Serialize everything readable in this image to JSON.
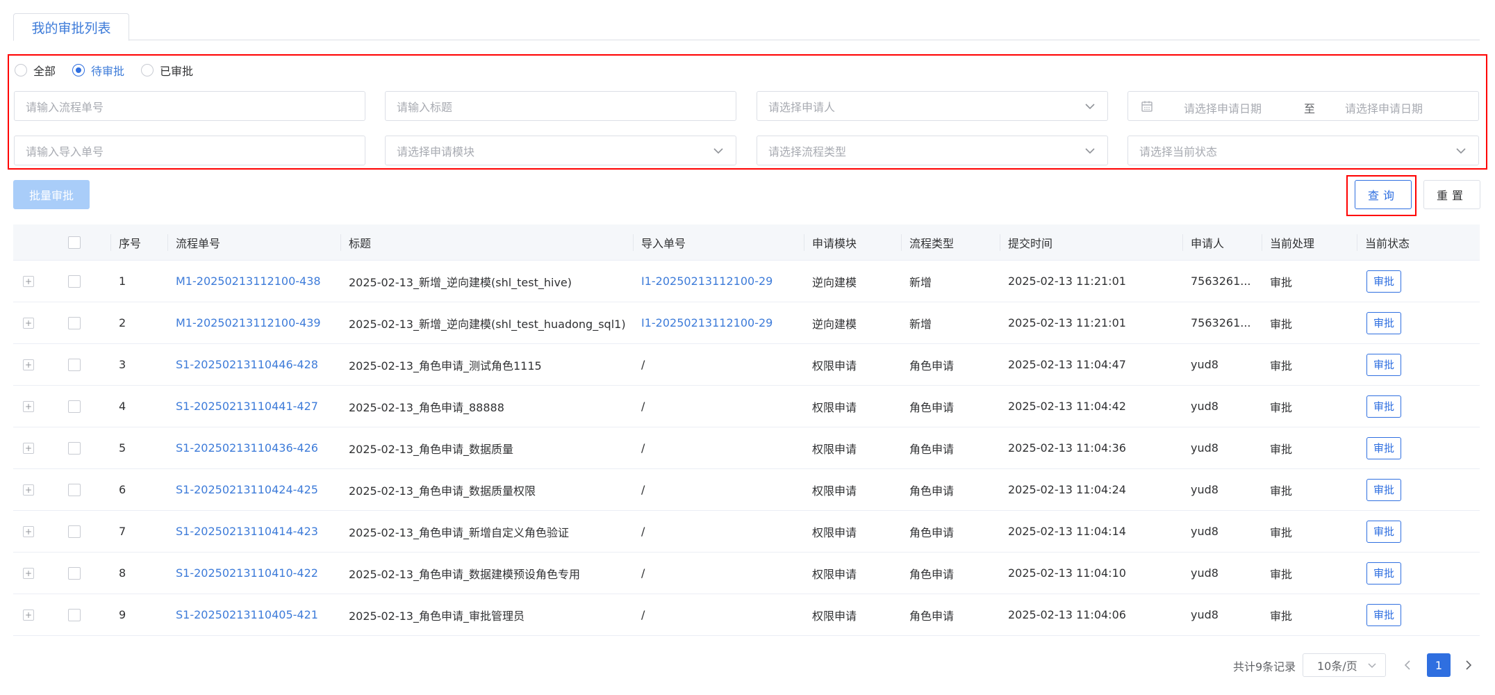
{
  "tab": {
    "label": "我的审批列表"
  },
  "filters": {
    "radios": [
      {
        "label": "全部",
        "checked": false
      },
      {
        "label": "待审批",
        "checked": true
      },
      {
        "label": "已审批",
        "checked": false
      }
    ],
    "process_no_placeholder": "请输入流程单号",
    "title_placeholder": "请输入标题",
    "applicant_placeholder": "请选择申请人",
    "date_start_placeholder": "请选择申请日期",
    "date_separator": "至",
    "date_end_placeholder": "请选择申请日期",
    "import_no_placeholder": "请输入导入单号",
    "module_placeholder": "请选择申请模块",
    "process_type_placeholder": "请选择流程类型",
    "status_placeholder": "请选择当前状态"
  },
  "buttons": {
    "batch": "批量审批",
    "query": "查询",
    "reset": "重置"
  },
  "table": {
    "headers": {
      "index": "序号",
      "process_no": "流程单号",
      "title": "标题",
      "import_no": "导入单号",
      "module": "申请模块",
      "process_type": "流程类型",
      "submit_time": "提交时间",
      "applicant": "申请人",
      "handler": "当前处理",
      "status": "当前状态"
    },
    "rows": [
      {
        "index": "1",
        "process_no": "M1-20250213112100-438",
        "title": "2025-02-13_新增_逆向建模(shl_test_hive)",
        "import_no": "I1-20250213112100-29",
        "import_is_link": true,
        "module": "逆向建模",
        "process_type": "新增",
        "submit_time": "2025-02-13 11:21:01",
        "applicant": "7563261...",
        "handler": "审批",
        "status": "审批"
      },
      {
        "index": "2",
        "process_no": "M1-20250213112100-439",
        "title": "2025-02-13_新增_逆向建模(shl_test_huadong_sql1)",
        "import_no": "I1-20250213112100-29",
        "import_is_link": true,
        "module": "逆向建模",
        "process_type": "新增",
        "submit_time": "2025-02-13 11:21:01",
        "applicant": "7563261...",
        "handler": "审批",
        "status": "审批"
      },
      {
        "index": "3",
        "process_no": "S1-20250213110446-428",
        "title": "2025-02-13_角色申请_测试角色1115",
        "import_no": "/",
        "import_is_link": false,
        "module": "权限申请",
        "process_type": "角色申请",
        "submit_time": "2025-02-13 11:04:47",
        "applicant": "yud8",
        "handler": "审批",
        "status": "审批"
      },
      {
        "index": "4",
        "process_no": "S1-20250213110441-427",
        "title": "2025-02-13_角色申请_88888",
        "import_no": "/",
        "import_is_link": false,
        "module": "权限申请",
        "process_type": "角色申请",
        "submit_time": "2025-02-13 11:04:42",
        "applicant": "yud8",
        "handler": "审批",
        "status": "审批"
      },
      {
        "index": "5",
        "process_no": "S1-20250213110436-426",
        "title": "2025-02-13_角色申请_数据质量",
        "import_no": "/",
        "import_is_link": false,
        "module": "权限申请",
        "process_type": "角色申请",
        "submit_time": "2025-02-13 11:04:36",
        "applicant": "yud8",
        "handler": "审批",
        "status": "审批"
      },
      {
        "index": "6",
        "process_no": "S1-20250213110424-425",
        "title": "2025-02-13_角色申请_数据质量权限",
        "import_no": "/",
        "import_is_link": false,
        "module": "权限申请",
        "process_type": "角色申请",
        "submit_time": "2025-02-13 11:04:24",
        "applicant": "yud8",
        "handler": "审批",
        "status": "审批"
      },
      {
        "index": "7",
        "process_no": "S1-20250213110414-423",
        "title": "2025-02-13_角色申请_新增自定义角色验证",
        "import_no": "/",
        "import_is_link": false,
        "module": "权限申请",
        "process_type": "角色申请",
        "submit_time": "2025-02-13 11:04:14",
        "applicant": "yud8",
        "handler": "审批",
        "status": "审批"
      },
      {
        "index": "8",
        "process_no": "S1-20250213110410-422",
        "title": "2025-02-13_角色申请_数据建模预设角色专用",
        "import_no": "/",
        "import_is_link": false,
        "module": "权限申请",
        "process_type": "角色申请",
        "submit_time": "2025-02-13 11:04:10",
        "applicant": "yud8",
        "handler": "审批",
        "status": "审批"
      },
      {
        "index": "9",
        "process_no": "S1-20250213110405-421",
        "title": "2025-02-13_角色申请_审批管理员",
        "import_no": "/",
        "import_is_link": false,
        "module": "权限申请",
        "process_type": "角色申请",
        "submit_time": "2025-02-13 11:04:06",
        "applicant": "yud8",
        "handler": "审批",
        "status": "审批"
      }
    ]
  },
  "pagination": {
    "total_text": "共计9条记录",
    "page_size": "10条/页",
    "current_page": "1"
  },
  "colors": {
    "primary": "#2f6fe0",
    "link": "#3d7bd9",
    "highlight_border": "#ff0000",
    "disabled_button": "#a9cdf9"
  },
  "icons": [
    "calendar-icon",
    "chevron-down-icon",
    "chevron-left-icon",
    "chevron-right-icon",
    "expand-icon"
  ]
}
